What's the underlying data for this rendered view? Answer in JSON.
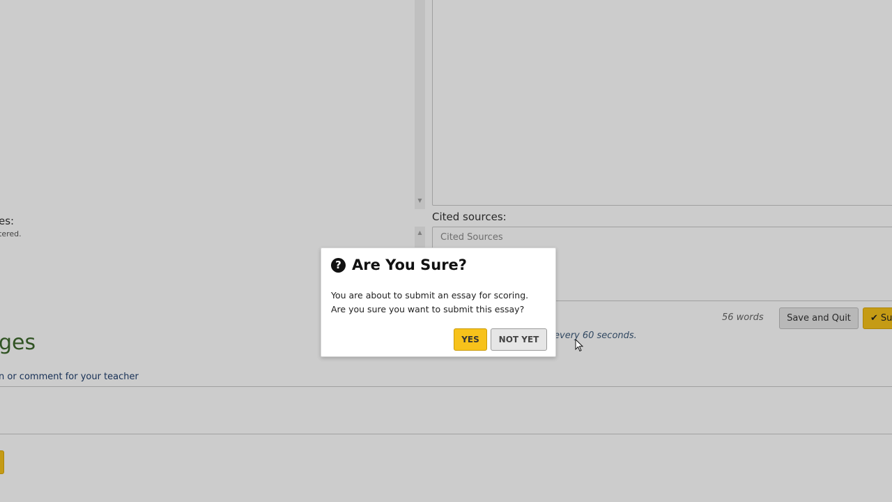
{
  "left_panel": {
    "label": "es:",
    "sub": "tered."
  },
  "essay": {
    "cited_label": "Cited sources:",
    "cited_placeholder": "Cited Sources"
  },
  "toolbar": {
    "word_count": "56 words",
    "save_quit_label": "Save and Quit",
    "submit_label": "Su",
    "autosave_note": "every 60 seconds."
  },
  "messages": {
    "heading": "ges",
    "link": "n or comment for your teacher"
  },
  "dialog": {
    "title": "Are You Sure?",
    "icon": "question-circle-icon",
    "line1": "You are about to submit an essay for scoring.",
    "line2": "Are you sure you want to submit this essay?",
    "yes_label": "YES",
    "not_yet_label": "NOT YET"
  },
  "colors": {
    "accent": "#f7c21b",
    "heading_green": "#3e6a2e",
    "link_blue": "#1f3e6d"
  }
}
